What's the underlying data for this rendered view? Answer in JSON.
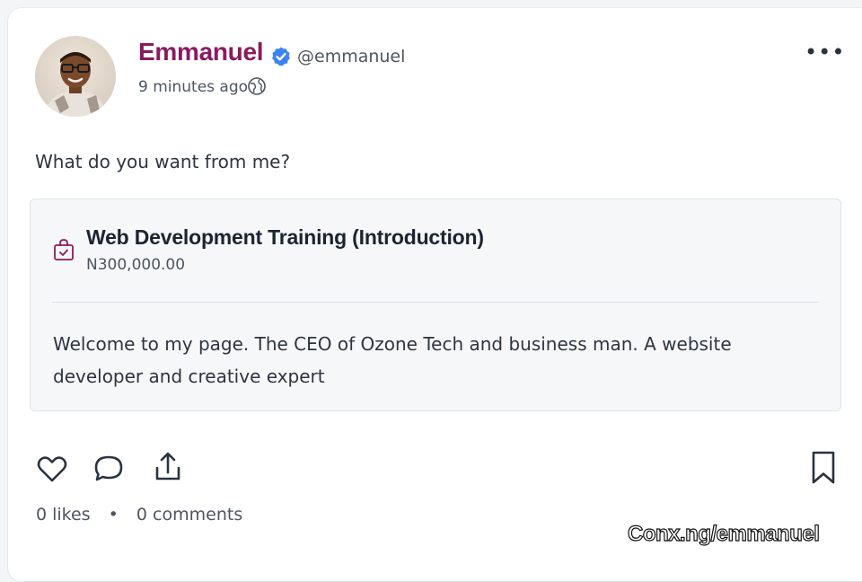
{
  "post": {
    "author_name": "Emmanuel",
    "author_handle": "@emmanuel",
    "timestamp": "9 minutes ago",
    "visibility_icon": "globe-icon",
    "verified_icon": "verified-badge-icon",
    "more_label": "•••",
    "text": "What do you want from me?"
  },
  "product": {
    "icon": "shopping-bag-icon",
    "title": "Web Development Training (Introduction)",
    "price": "N300,000.00",
    "description": "Welcome to my page. The CEO of Ozone Tech and business man. A website developer and creative expert"
  },
  "actions": {
    "like_icon": "heart-icon",
    "comment_icon": "comment-icon",
    "share_icon": "share-icon",
    "bookmark_icon": "bookmark-icon"
  },
  "stats": {
    "likes": "0 likes",
    "separator": "•",
    "comments": "0 comments"
  },
  "watermark": "Conx.ng/emmanuel",
  "colors": {
    "accent": "#8c1a5e",
    "verified": "#3b82f6",
    "text": "#2d3540",
    "muted": "#4d5560"
  }
}
